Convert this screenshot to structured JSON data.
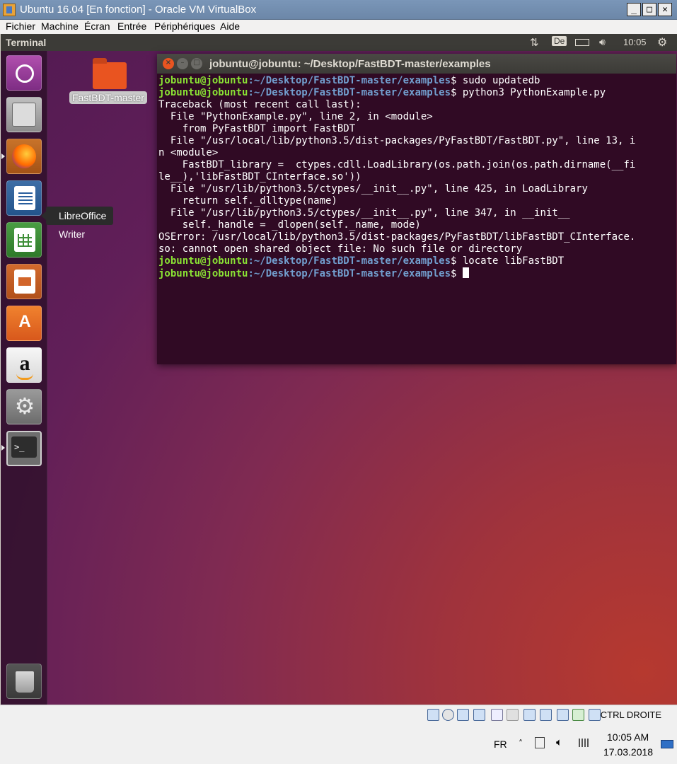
{
  "host_window": {
    "title": "Ubuntu 16.04 [En fonction] - Oracle VM VirtualBox",
    "menu": [
      "Fichier",
      "Machine",
      "Écran",
      "Entrée",
      "Périphériques",
      "Aide"
    ],
    "minimize": "_",
    "maximize": "□",
    "close": "✕"
  },
  "guest_topbar": {
    "app_name": "Terminal",
    "keyboard_layout": "De",
    "time": "10:05"
  },
  "launcher": {
    "items": [
      "dash-home",
      "files",
      "firefox",
      "libreoffice-writer",
      "libreoffice-calc",
      "libreoffice-impress",
      "ubuntu-software",
      "amazon",
      "system-settings",
      "terminal",
      "trash"
    ],
    "tooltip": "LibreOffice Writer"
  },
  "desktop": {
    "folder_label": "FastBDT-master"
  },
  "terminal": {
    "title": "jobuntu@jobuntu: ~/Desktop/FastBDT-master/examples",
    "prompt_user": "jobuntu@jobuntu",
    "prompt_path": ":~/Desktop/FastBDT-master/examples",
    "commands": [
      "$ sudo updatedb",
      "$ python3 PythonExample.py",
      "$ locate libFastBDT",
      "$ "
    ],
    "output": [
      "Traceback (most recent call last):",
      "  File \"PythonExample.py\", line 2, in <module>",
      "    from PyFastBDT import FastBDT",
      "  File \"/usr/local/lib/python3.5/dist-packages/PyFastBDT/FastBDT.py\", line 13, i",
      "n <module>",
      "    FastBDT_library =  ctypes.cdll.LoadLibrary(os.path.join(os.path.dirname(__fi",
      "le__),'libFastBDT_CInterface.so'))",
      "  File \"/usr/lib/python3.5/ctypes/__init__.py\", line 425, in LoadLibrary",
      "    return self._dlltype(name)",
      "  File \"/usr/lib/python3.5/ctypes/__init__.py\", line 347, in __init__",
      "    self._handle = _dlopen(self._name, mode)",
      "OSError: /usr/local/lib/python3.5/dist-packages/PyFastBDT/libFastBDT_CInterface.",
      "so: cannot open shared object file: No such file or directory"
    ]
  },
  "vbox_status": {
    "host_key": "CTRL DROITE"
  },
  "taskbar": {
    "language": "FR",
    "time": "10:05 AM",
    "date": "17.03.2018"
  }
}
